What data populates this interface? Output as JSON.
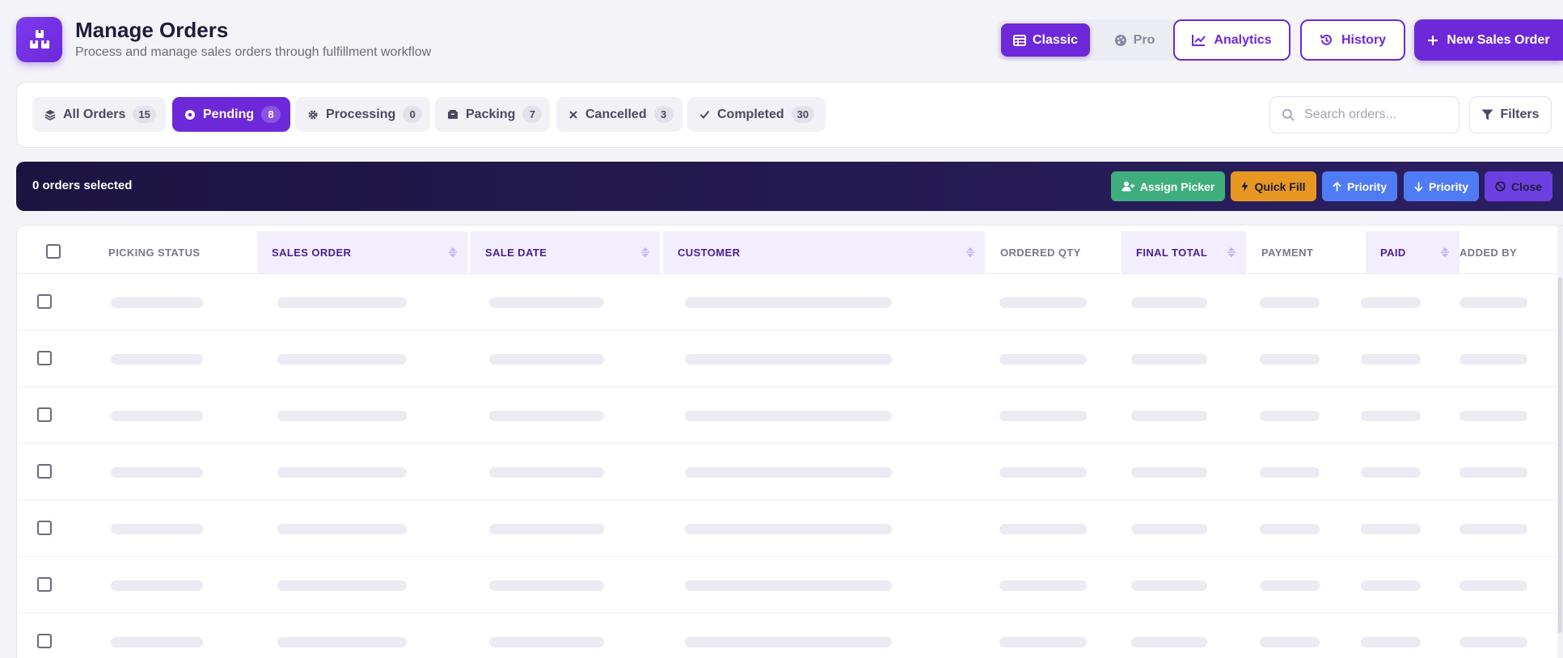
{
  "header": {
    "title": "Manage Orders",
    "subtitle": "Process and manage sales orders through fulfillment workflow",
    "view_toggle": {
      "classic": "Classic",
      "pro": "Pro"
    },
    "analytics": "Analytics",
    "history": "History",
    "new_order": "New Sales Order"
  },
  "tabs": [
    {
      "label": "All Orders",
      "count": "15",
      "icon": "layers-icon"
    },
    {
      "label": "Pending",
      "count": "8",
      "icon": "pending-icon",
      "active": true
    },
    {
      "label": "Processing",
      "count": "0",
      "icon": "gear-icon"
    },
    {
      "label": "Packing",
      "count": "7",
      "icon": "box-icon"
    },
    {
      "label": "Cancelled",
      "count": "3",
      "icon": "x-icon"
    },
    {
      "label": "Completed",
      "count": "30",
      "icon": "check-icon"
    }
  ],
  "search": {
    "placeholder": "Search orders..."
  },
  "filters": "Filters",
  "selection": {
    "text": "0 orders selected",
    "assign": "Assign Picker",
    "quick_fill": "Quick Fill",
    "priority_up": "Priority",
    "priority_down": "Priority",
    "close": "Close"
  },
  "table": {
    "columns": [
      "PICKING STATUS",
      "SALES ORDER",
      "SALE DATE",
      "CUSTOMER",
      "ORDERED QTY",
      "FINAL TOTAL",
      "PAYMENT",
      "PAID",
      "ADDED BY"
    ],
    "row_state": "loading"
  },
  "colors": {
    "accent": "#6d28d9",
    "selection_bar": "#1c1440",
    "assign": "#3fae7d",
    "quick_fill": "#e69823",
    "priority": "#4f7cf5"
  }
}
